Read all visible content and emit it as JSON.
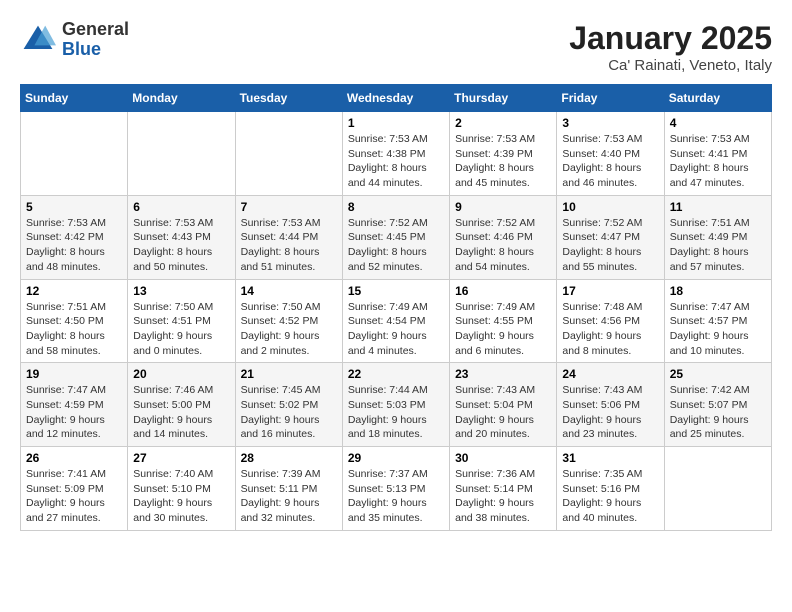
{
  "header": {
    "logo": {
      "general": "General",
      "blue": "Blue"
    },
    "title": "January 2025",
    "location": "Ca' Rainati, Veneto, Italy"
  },
  "weekdays": [
    "Sunday",
    "Monday",
    "Tuesday",
    "Wednesday",
    "Thursday",
    "Friday",
    "Saturday"
  ],
  "weeks": [
    [
      {
        "day": "",
        "info": ""
      },
      {
        "day": "",
        "info": ""
      },
      {
        "day": "",
        "info": ""
      },
      {
        "day": "1",
        "info": "Sunrise: 7:53 AM\nSunset: 4:38 PM\nDaylight: 8 hours\nand 44 minutes."
      },
      {
        "day": "2",
        "info": "Sunrise: 7:53 AM\nSunset: 4:39 PM\nDaylight: 8 hours\nand 45 minutes."
      },
      {
        "day": "3",
        "info": "Sunrise: 7:53 AM\nSunset: 4:40 PM\nDaylight: 8 hours\nand 46 minutes."
      },
      {
        "day": "4",
        "info": "Sunrise: 7:53 AM\nSunset: 4:41 PM\nDaylight: 8 hours\nand 47 minutes."
      }
    ],
    [
      {
        "day": "5",
        "info": "Sunrise: 7:53 AM\nSunset: 4:42 PM\nDaylight: 8 hours\nand 48 minutes."
      },
      {
        "day": "6",
        "info": "Sunrise: 7:53 AM\nSunset: 4:43 PM\nDaylight: 8 hours\nand 50 minutes."
      },
      {
        "day": "7",
        "info": "Sunrise: 7:53 AM\nSunset: 4:44 PM\nDaylight: 8 hours\nand 51 minutes."
      },
      {
        "day": "8",
        "info": "Sunrise: 7:52 AM\nSunset: 4:45 PM\nDaylight: 8 hours\nand 52 minutes."
      },
      {
        "day": "9",
        "info": "Sunrise: 7:52 AM\nSunset: 4:46 PM\nDaylight: 8 hours\nand 54 minutes."
      },
      {
        "day": "10",
        "info": "Sunrise: 7:52 AM\nSunset: 4:47 PM\nDaylight: 8 hours\nand 55 minutes."
      },
      {
        "day": "11",
        "info": "Sunrise: 7:51 AM\nSunset: 4:49 PM\nDaylight: 8 hours\nand 57 minutes."
      }
    ],
    [
      {
        "day": "12",
        "info": "Sunrise: 7:51 AM\nSunset: 4:50 PM\nDaylight: 8 hours\nand 58 minutes."
      },
      {
        "day": "13",
        "info": "Sunrise: 7:50 AM\nSunset: 4:51 PM\nDaylight: 9 hours\nand 0 minutes."
      },
      {
        "day": "14",
        "info": "Sunrise: 7:50 AM\nSunset: 4:52 PM\nDaylight: 9 hours\nand 2 minutes."
      },
      {
        "day": "15",
        "info": "Sunrise: 7:49 AM\nSunset: 4:54 PM\nDaylight: 9 hours\nand 4 minutes."
      },
      {
        "day": "16",
        "info": "Sunrise: 7:49 AM\nSunset: 4:55 PM\nDaylight: 9 hours\nand 6 minutes."
      },
      {
        "day": "17",
        "info": "Sunrise: 7:48 AM\nSunset: 4:56 PM\nDaylight: 9 hours\nand 8 minutes."
      },
      {
        "day": "18",
        "info": "Sunrise: 7:47 AM\nSunset: 4:57 PM\nDaylight: 9 hours\nand 10 minutes."
      }
    ],
    [
      {
        "day": "19",
        "info": "Sunrise: 7:47 AM\nSunset: 4:59 PM\nDaylight: 9 hours\nand 12 minutes."
      },
      {
        "day": "20",
        "info": "Sunrise: 7:46 AM\nSunset: 5:00 PM\nDaylight: 9 hours\nand 14 minutes."
      },
      {
        "day": "21",
        "info": "Sunrise: 7:45 AM\nSunset: 5:02 PM\nDaylight: 9 hours\nand 16 minutes."
      },
      {
        "day": "22",
        "info": "Sunrise: 7:44 AM\nSunset: 5:03 PM\nDaylight: 9 hours\nand 18 minutes."
      },
      {
        "day": "23",
        "info": "Sunrise: 7:43 AM\nSunset: 5:04 PM\nDaylight: 9 hours\nand 20 minutes."
      },
      {
        "day": "24",
        "info": "Sunrise: 7:43 AM\nSunset: 5:06 PM\nDaylight: 9 hours\nand 23 minutes."
      },
      {
        "day": "25",
        "info": "Sunrise: 7:42 AM\nSunset: 5:07 PM\nDaylight: 9 hours\nand 25 minutes."
      }
    ],
    [
      {
        "day": "26",
        "info": "Sunrise: 7:41 AM\nSunset: 5:09 PM\nDaylight: 9 hours\nand 27 minutes."
      },
      {
        "day": "27",
        "info": "Sunrise: 7:40 AM\nSunset: 5:10 PM\nDaylight: 9 hours\nand 30 minutes."
      },
      {
        "day": "28",
        "info": "Sunrise: 7:39 AM\nSunset: 5:11 PM\nDaylight: 9 hours\nand 32 minutes."
      },
      {
        "day": "29",
        "info": "Sunrise: 7:37 AM\nSunset: 5:13 PM\nDaylight: 9 hours\nand 35 minutes."
      },
      {
        "day": "30",
        "info": "Sunrise: 7:36 AM\nSunset: 5:14 PM\nDaylight: 9 hours\nand 38 minutes."
      },
      {
        "day": "31",
        "info": "Sunrise: 7:35 AM\nSunset: 5:16 PM\nDaylight: 9 hours\nand 40 minutes."
      },
      {
        "day": "",
        "info": ""
      }
    ]
  ]
}
